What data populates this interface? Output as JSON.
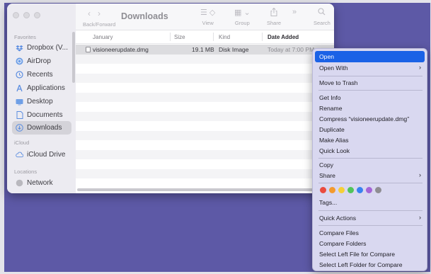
{
  "finder": {
    "title": "Downloads",
    "nav_label": "Back/Forward",
    "toolbar": {
      "view": "View",
      "group": "Group",
      "share": "Share",
      "search": "Search"
    },
    "sidebar": {
      "favorites_label": "Favorites",
      "icloud_label": "iCloud",
      "locations_label": "Locations",
      "items": [
        {
          "label": "Dropbox (V...",
          "icon": "dropbox-icon"
        },
        {
          "label": "AirDrop",
          "icon": "airdrop-icon"
        },
        {
          "label": "Recents",
          "icon": "clock-icon"
        },
        {
          "label": "Applications",
          "icon": "applications-icon"
        },
        {
          "label": "Desktop",
          "icon": "desktop-icon"
        },
        {
          "label": "Documents",
          "icon": "document-icon"
        },
        {
          "label": "Downloads",
          "icon": "downloads-icon",
          "active": true
        }
      ],
      "icloud_items": [
        {
          "label": "iCloud Drive",
          "icon": "cloud-icon"
        }
      ],
      "location_items": [
        {
          "label": "Network",
          "icon": "network-icon"
        }
      ]
    },
    "columns": {
      "name": "January",
      "size": "Size",
      "kind": "Kind",
      "date": "Date Added"
    },
    "files": [
      {
        "name": "visioneerupdate.dmg",
        "size": "19.1 MB",
        "kind": "Disk Image",
        "date": "Today at 7:00 PM"
      }
    ]
  },
  "context_menu": {
    "open": "Open",
    "open_with": "Open With",
    "move_to_trash": "Move to Trash",
    "get_info": "Get Info",
    "rename": "Rename",
    "compress": "Compress “visioneerupdate.dmg”",
    "duplicate": "Duplicate",
    "make_alias": "Make Alias",
    "quick_look": "Quick Look",
    "copy": "Copy",
    "share": "Share",
    "tags": "Tags...",
    "quick_actions": "Quick Actions",
    "compare_files": "Compare Files",
    "compare_folders": "Compare Folders",
    "select_left_file": "Select Left File for Compare",
    "select_left_folder": "Select Left Folder for Compare",
    "tag_colors": [
      "#ea4b3f",
      "#f39a2e",
      "#f5cf37",
      "#52c45a",
      "#3a82f0",
      "#a565d6",
      "#8e8d92"
    ]
  },
  "colors": {
    "desktop": "#5d59a6",
    "menu_highlight": "#1b62e6"
  }
}
